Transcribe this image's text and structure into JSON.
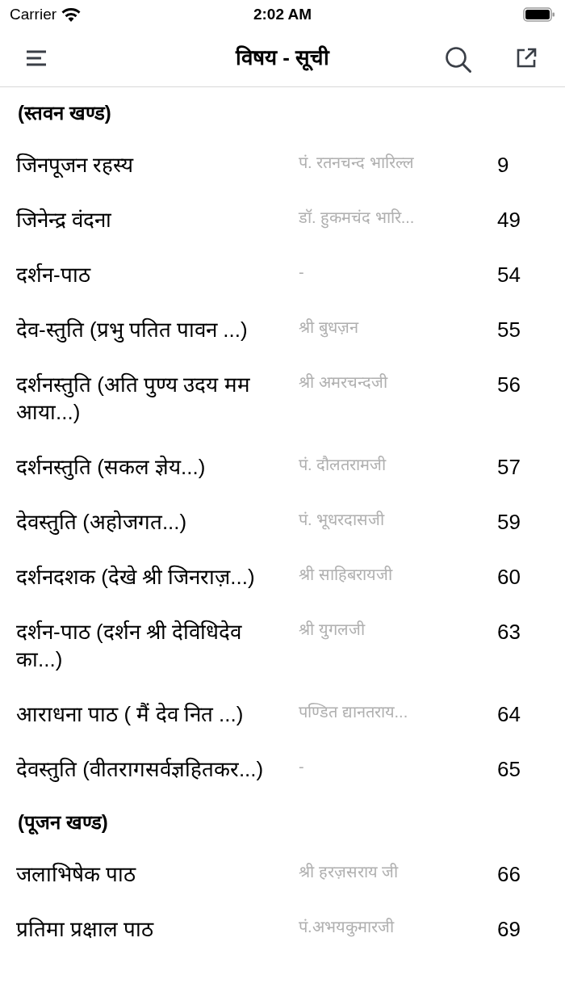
{
  "status_bar": {
    "carrier": "Carrier",
    "time": "2:02 AM"
  },
  "nav_bar": {
    "title": "विषय - सूची"
  },
  "sections": [
    {
      "heading": "(स्तवन खण्ड)",
      "entries": [
        {
          "title": "जिनपूजन रहस्य",
          "author": "पं. रतनचन्द भारिल्ल",
          "page": "9"
        },
        {
          "title": "जिनेन्द्र वंदना",
          "author": "डॉ. हुकमचंद भारि...",
          "page": "49"
        },
        {
          "title": "दर्शन-पाठ",
          "author": "-",
          "page": "54"
        },
        {
          "title": "देव-स्तुति (प्रभु पतित पावन ...)",
          "author": "श्री बुधज़न",
          "page": "55"
        },
        {
          "title": "दर्शनस्तुति (अति पुण्य उदय मम आया...)",
          "author": "श्री अमरचन्दजी",
          "page": "56"
        },
        {
          "title": "दर्शनस्तुति (सकल ज्ञेय...)",
          "author": "पं. दौलतरामजी",
          "page": "57"
        },
        {
          "title": "देवस्तुति (अहोजगत...)",
          "author": "पं. भूधरदासजी",
          "page": "59"
        },
        {
          "title": "दर्शनदशक (देखे श्री जिनराज़...)",
          "author": "श्री साहिबरायजी",
          "page": "60"
        },
        {
          "title": "दर्शन-पाठ (दर्शन श्री देविधिदेव का...)",
          "author": "श्री युगलजी",
          "page": "63"
        },
        {
          "title": "आराधना पाठ ( मैं देव नित ...)",
          "author": "पण्डित द्यानतराय...",
          "page": "64"
        },
        {
          "title": "देवस्तुति (वीतरागसर्वज्ञहितकर...)",
          "author": "-",
          "page": "65"
        }
      ]
    },
    {
      "heading": "(पूजन खण्ड)",
      "entries": [
        {
          "title": "जलाभिषेक पाठ",
          "author": "श्री हरज़सराय जी",
          "page": "66"
        },
        {
          "title": "प्रतिमा प्रक्षाल पाठ",
          "author": "पं.अभयकुमारजी",
          "page": "69"
        }
      ]
    }
  ]
}
